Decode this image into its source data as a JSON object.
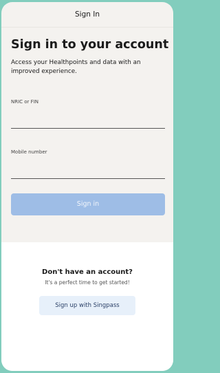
{
  "header": {
    "title": "Sign In"
  },
  "main": {
    "headline": "Sign in to your account",
    "subtitle": "Access your Healthpoints and data with an improved experience.",
    "nric_field": {
      "label": "NRIC or FIN",
      "value": ""
    },
    "mobile_field": {
      "label": "Mobile number",
      "value": ""
    },
    "signin_button": "Sign in"
  },
  "signup": {
    "title": "Don't have an account?",
    "subtitle": "It's a perfect time to get started!",
    "button": "Sign up with Singpass"
  },
  "colors": {
    "background": "#82cdbd",
    "surface": "#f4f2ef",
    "signin_button": "#9ebde6",
    "singpass_button": "#e7f0fa"
  }
}
